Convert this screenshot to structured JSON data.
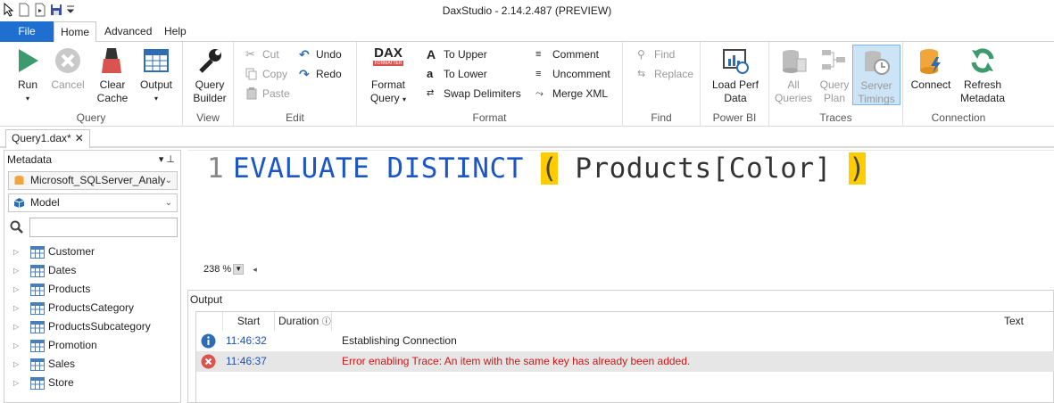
{
  "window": {
    "title": "DaxStudio - 2.14.2.487 (PREVIEW)"
  },
  "ribbon_tabs": {
    "file": "File",
    "home": "Home",
    "advanced": "Advanced",
    "help": "Help"
  },
  "groups": {
    "query": {
      "label": "Query",
      "run": "Run",
      "cancel": "Cancel",
      "clear_cache_1": "Clear",
      "clear_cache_2": "Cache",
      "output": "Output"
    },
    "view": {
      "label": "View",
      "qb_1": "Query",
      "qb_2": "Builder"
    },
    "edit": {
      "label": "Edit",
      "cut": "Cut",
      "copy": "Copy",
      "paste": "Paste",
      "undo": "Undo",
      "redo": "Redo"
    },
    "format": {
      "label": "Format",
      "format_query_1": "Format",
      "format_query_2": "Query",
      "to_upper": "To Upper",
      "to_lower": "To Lower",
      "swap_delimiters": "Swap Delimiters",
      "comment": "Comment",
      "uncomment": "Uncomment",
      "merge_xml": "Merge XML",
      "dax_logo": "DAX",
      "dax_logo_sub": "FORMATTER"
    },
    "find": {
      "label": "Find",
      "find": "Find",
      "replace": "Replace"
    },
    "powerbi": {
      "label": "Power BI",
      "load_1": "Load Perf",
      "load_2": "Data"
    },
    "traces": {
      "label": "Traces",
      "all_1": "All",
      "all_2": "Queries",
      "plan_1": "Query",
      "plan_2": "Plan",
      "timings_1": "Server",
      "timings_2": "Timings"
    },
    "connection": {
      "label": "Connection",
      "connect": "Connect",
      "refresh_1": "Refresh",
      "refresh_2": "Metadata"
    }
  },
  "document_tab": {
    "name": "Query1.dax*",
    "close": "✕"
  },
  "metadata": {
    "header": "Metadata",
    "controls": "▾ ⊥",
    "server": "Microsoft_SQLServer_Analy",
    "model": "Model",
    "search_value": "",
    "tables": [
      "Customer",
      "Dates",
      "Products",
      "ProductsCategory",
      "ProductsSubcategory",
      "Promotion",
      "Sales",
      "Store"
    ]
  },
  "editor": {
    "line_number": "1",
    "code": {
      "kw1": "EVALUATE",
      "kw2": "DISTINCT",
      "open": "(",
      "ident": "Products[Color]",
      "close": ")"
    },
    "zoom": "238 %"
  },
  "output": {
    "header": "Output",
    "columns": {
      "start": "Start",
      "duration": "Duration",
      "text": "Text"
    },
    "rows": [
      {
        "type": "info",
        "start": "11:46:32",
        "text": "Establishing Connection"
      },
      {
        "type": "error",
        "start": "11:46:37",
        "text": "Error enabling Trace: An item with the same key has already been added."
      }
    ]
  },
  "colors": {
    "accent": "#1e6fcf",
    "keyword": "#1a56c8",
    "bracket_highlight": "#ffcc00",
    "error_text": "#d01616"
  }
}
